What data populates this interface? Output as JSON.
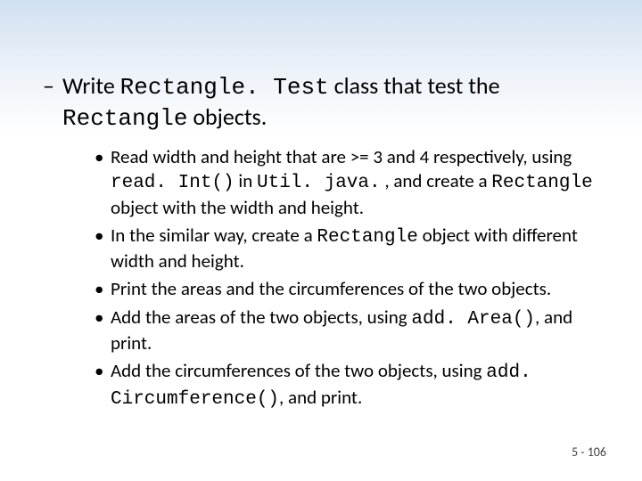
{
  "main": {
    "dash": "–",
    "part1": "Write ",
    "code1": "Rectangle. Test",
    "part2": " class that test the ",
    "code2": "Rectangle",
    "part3": " objects."
  },
  "sub": [
    {
      "bullet": "•",
      "segments": [
        {
          "t": "Read width and height that are >= 3 and 4 respectively, using "
        },
        {
          "t": "read. Int()",
          "mono": true
        },
        {
          "t": " in "
        },
        {
          "t": "Util. java.",
          "mono": true
        },
        {
          "t": " , and create a "
        },
        {
          "t": "Rectangle",
          "mono": true
        },
        {
          "t": " object with the width and height."
        }
      ]
    },
    {
      "bullet": "•",
      "segments": [
        {
          "t": "In the similar way, create a "
        },
        {
          "t": "Rectangle",
          "mono": true
        },
        {
          "t": " object with different width and height."
        }
      ]
    },
    {
      "bullet": "•",
      "segments": [
        {
          "t": "Print the areas and the circumferences of the two objects."
        }
      ]
    },
    {
      "bullet": "•",
      "segments": [
        {
          "t": "Add the areas of the two objects, using "
        },
        {
          "t": "add. Area()",
          "mono": true
        },
        {
          "t": ", and print."
        }
      ]
    },
    {
      "bullet": "•",
      "segments": [
        {
          "t": "Add the circumferences of the two objects, using "
        },
        {
          "t": "add. Circumference()",
          "mono": true
        },
        {
          "t": ", and print."
        }
      ]
    }
  ],
  "footer": "5 - 106"
}
